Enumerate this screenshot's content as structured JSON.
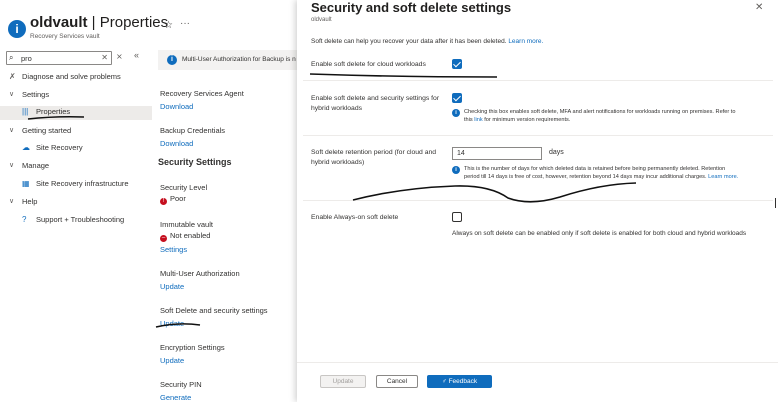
{
  "resource": {
    "name": "oldvault",
    "separator": " | ",
    "section": "Properties",
    "subtitle": "Recovery Services vault",
    "icon": "info-circle-icon"
  },
  "nav": {
    "search_value": "pro",
    "items": [
      {
        "label": "Diagnose and solve problems",
        "icon": "wrench-icon"
      },
      {
        "label": "Settings",
        "icon": "chevron-down-icon"
      },
      {
        "label": "Properties",
        "icon": "properties-bars-icon",
        "selected": true
      },
      {
        "label": "Getting started",
        "icon": "chevron-down-icon"
      },
      {
        "label": "Site Recovery",
        "icon": "cloud-icon"
      },
      {
        "label": "Manage",
        "icon": "chevron-down-icon"
      },
      {
        "label": "Site Recovery infrastructure",
        "icon": "grid-icon"
      },
      {
        "label": "Help",
        "icon": "chevron-down-icon"
      },
      {
        "label": "Support + Troubleshooting",
        "icon": "question-icon"
      }
    ]
  },
  "middle": {
    "banner": "Multi-User Authorization for Backup is n",
    "agent_label": "Recovery Services Agent",
    "agent_link": "Download",
    "creds_label": "Backup Credentials",
    "creds_link": "Download",
    "security_heading": "Security Settings",
    "security_level_label": "Security Level",
    "security_level_value": "Poor",
    "immutable_label": "Immutable vault",
    "immutable_value": "Not enabled",
    "immutable_link": "Settings",
    "mua_label": "Multi-User Authorization",
    "mua_link": "Update",
    "softdelete_label": "Soft Delete and security settings",
    "softdelete_link": "Update",
    "encryption_label": "Encryption Settings",
    "encryption_link": "Update",
    "pin_label": "Security PIN",
    "pin_link": "Generate"
  },
  "panel": {
    "title": "Security and soft delete settings",
    "subtitle": "oldvault",
    "description": "Soft delete can help you recover your data after it has been deleted.",
    "learn_more": "Learn more.",
    "row1_label": "Enable soft delete for cloud workloads",
    "row1_checked": true,
    "row2_label": "Enable soft delete and security settings for hybrid workloads",
    "row2_checked": true,
    "row2_note": "Checking this box enables soft delete, MFA and alert notifications for workloads running on premises. Refer to this",
    "row2_note_link": "link",
    "row2_note_end": "for minimum version requirements.",
    "row3_label": "Soft delete retention period (for cloud and hybrid workloads)",
    "row3_value": "14",
    "row3_unit": "days",
    "row3_note": "This is the number of days for which deleted data is retained before being permanently deleted. Retention period till 14 days is free of cost, however, retention beyond 14 days may incur additional charges.",
    "row3_note_link": "Learn more.",
    "row4_label": "Enable Always-on soft delete",
    "row4_checked": false,
    "row4_note": "Always on soft delete can be enabled only if soft delete is enabled for both cloud and hybrid workloads",
    "btn_update": "Update",
    "btn_cancel": "Cancel",
    "btn_feedback": "Feedback"
  },
  "colors": {
    "accent": "#0f6cbd",
    "error": "#c50f1f",
    "selected_bg": "#edebe9"
  }
}
